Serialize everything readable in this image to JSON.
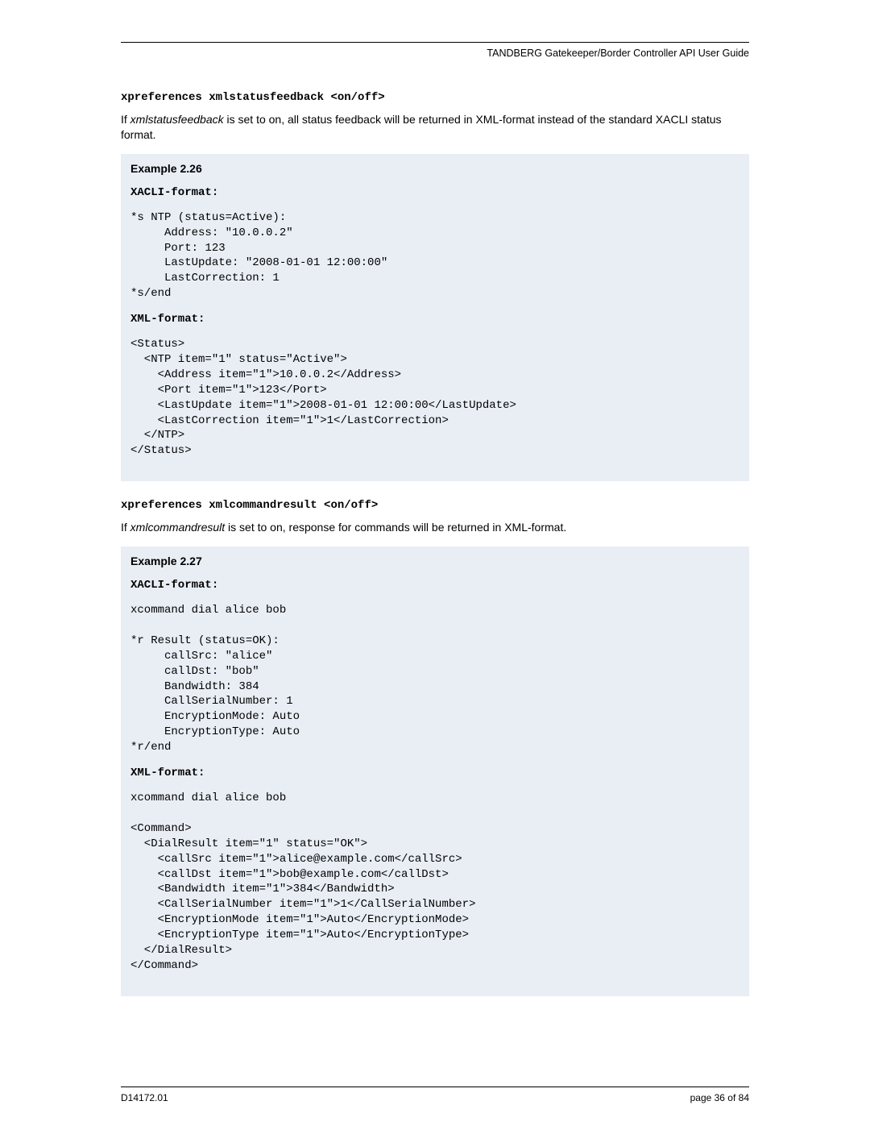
{
  "header": {
    "doc_title": "TANDBERG Gatekeeper/Border Controller API User Guide"
  },
  "section1": {
    "command": "xpreferences xmlstatusfeedback <on/off>",
    "body_prefix": "If ",
    "body_italic": "xmlstatusfeedback",
    "body_suffix": " is set to on, all status feedback will be returned in XML-format instead of the standard XACLI status format."
  },
  "example26": {
    "title": "Example 2.26",
    "xacli_label": "XACLI-format:",
    "xacli_code": "*s NTP (status=Active):\n     Address: \"10.0.0.2\"\n     Port: 123\n     LastUpdate: \"2008-01-01 12:00:00\"\n     LastCorrection: 1\n*s/end",
    "xml_label": "XML-format:",
    "xml_code": "<Status>\n  <NTP item=\"1\" status=\"Active\">\n    <Address item=\"1\">10.0.0.2</Address>\n    <Port item=\"1\">123</Port>\n    <LastUpdate item=\"1\">2008-01-01 12:00:00</LastUpdate>\n    <LastCorrection item=\"1\">1</LastCorrection>\n  </NTP>\n</Status>"
  },
  "section2": {
    "command": "xpreferences xmlcommandresult <on/off>",
    "body_prefix": "If ",
    "body_italic": "xmlcommandresult",
    "body_suffix": " is set to on, response for commands will be returned in XML-format."
  },
  "example27": {
    "title": "Example 2.27",
    "xacli_label": "XACLI-format:",
    "xacli_code": "xcommand dial alice bob\n\n*r Result (status=OK):\n     callSrc: \"alice\"\n     callDst: \"bob\"\n     Bandwidth: 384\n     CallSerialNumber: 1\n     EncryptionMode: Auto\n     EncryptionType: Auto\n*r/end",
    "xml_label": "XML-format:",
    "xml_code": "xcommand dial alice bob\n\n<Command>\n  <DialResult item=\"1\" status=\"OK\">\n    <callSrc item=\"1\">alice@example.com</callSrc>\n    <callDst item=\"1\">bob@example.com</callDst>\n    <Bandwidth item=\"1\">384</Bandwidth>\n    <CallSerialNumber item=\"1\">1</CallSerialNumber>\n    <EncryptionMode item=\"1\">Auto</EncryptionMode>\n    <EncryptionType item=\"1\">Auto</EncryptionType>\n  </DialResult>\n</Command>"
  },
  "footer": {
    "doc_id": "D14172.01",
    "page": "page 36 of 84"
  }
}
